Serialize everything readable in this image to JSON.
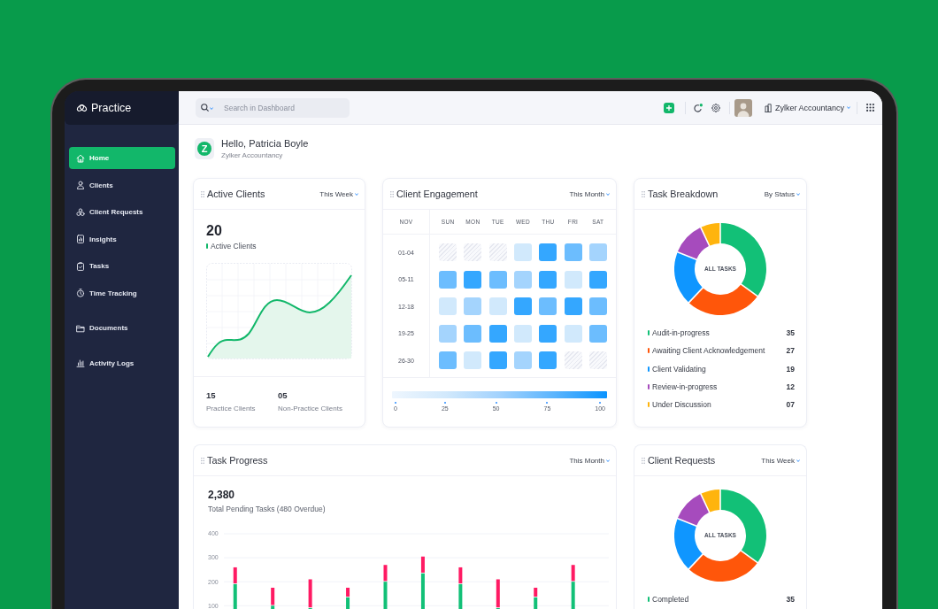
{
  "sidebar": {
    "app_name": "Practice",
    "sections": [
      {
        "items": [
          {
            "label": "Home",
            "selected": true
          },
          {
            "label": "Clients",
            "selected": false
          },
          {
            "label": "Client Requests",
            "selected": false
          },
          {
            "label": "Insights",
            "selected": false
          },
          {
            "label": "Tasks",
            "selected": false
          },
          {
            "label": "Time Tracking",
            "selected": false
          }
        ]
      },
      {
        "items": [
          {
            "label": "Documents",
            "selected": false
          }
        ]
      },
      {
        "items": [
          {
            "label": "Activity Logs",
            "selected": false
          }
        ]
      }
    ]
  },
  "top_bar": {
    "search": {
      "placeholder": "Search in Dashboard"
    },
    "organization": "Zylker Accountancy"
  },
  "greeting": {
    "logo_text": "Z",
    "title": "Hello, Patricia Boyle",
    "subtitle": "Zylker Accountancy"
  },
  "active_clients": {
    "title": "Active Clients",
    "period": "This Week",
    "count": "20",
    "count_label": "Active Clients",
    "stats": [
      {
        "value": "15",
        "label": "Practice Clients"
      },
      {
        "value": "05",
        "label": "Non-Practice Clients"
      }
    ]
  },
  "client_engagement": {
    "title": "Client Engagement",
    "period": "This Month",
    "month": "NOV",
    "days": [
      "SUN",
      "MON",
      "TUE",
      "WED",
      "THU",
      "FRI",
      "SAT"
    ],
    "rows": [
      {
        "label": "01-04",
        "cells": [
          {
            "kind": "blank"
          },
          {
            "kind": "blank"
          },
          {
            "kind": "blank"
          },
          {
            "kind": "filled",
            "color": "#d1e9fc"
          },
          {
            "kind": "filled",
            "color": "#34a7ff"
          },
          {
            "kind": "filled",
            "color": "#6cbdfe"
          },
          {
            "kind": "filled",
            "color": "#a4d4fd"
          }
        ]
      },
      {
        "label": "05-11",
        "cells": [
          {
            "kind": "filled",
            "color": "#6cbdfe"
          },
          {
            "kind": "filled",
            "color": "#34a7ff"
          },
          {
            "kind": "filled",
            "color": "#6cbdfe"
          },
          {
            "kind": "filled",
            "color": "#a4d4fd"
          },
          {
            "kind": "filled",
            "color": "#34a7ff"
          },
          {
            "kind": "filled",
            "color": "#d1e9fc"
          },
          {
            "kind": "filled",
            "color": "#34a7ff"
          }
        ]
      },
      {
        "label": "12-18",
        "cells": [
          {
            "kind": "filled",
            "color": "#d1e9fc"
          },
          {
            "kind": "filled",
            "color": "#a4d4fd"
          },
          {
            "kind": "filled",
            "color": "#d1e9fc"
          },
          {
            "kind": "filled",
            "color": "#34a7ff"
          },
          {
            "kind": "filled",
            "color": "#6cbdfe"
          },
          {
            "kind": "filled",
            "color": "#34a7ff"
          },
          {
            "kind": "filled",
            "color": "#6cbdfe"
          }
        ]
      },
      {
        "label": "19-25",
        "cells": [
          {
            "kind": "filled",
            "color": "#a4d4fd"
          },
          {
            "kind": "filled",
            "color": "#6cbdfe"
          },
          {
            "kind": "filled",
            "color": "#34a7ff"
          },
          {
            "kind": "filled",
            "color": "#d1e9fc"
          },
          {
            "kind": "filled",
            "color": "#34a7ff"
          },
          {
            "kind": "filled",
            "color": "#d1e9fc"
          },
          {
            "kind": "filled",
            "color": "#6cbdfe"
          }
        ]
      },
      {
        "label": "26-30",
        "cells": [
          {
            "kind": "filled",
            "color": "#6cbdfe"
          },
          {
            "kind": "filled",
            "color": "#d1e9fc"
          },
          {
            "kind": "filled",
            "color": "#34a7ff"
          },
          {
            "kind": "filled",
            "color": "#a4d4fd"
          },
          {
            "kind": "filled",
            "color": "#34a7ff"
          },
          {
            "kind": "blank"
          },
          {
            "kind": "blank"
          }
        ]
      }
    ],
    "scale_ticks": [
      "0",
      "25",
      "50",
      "75",
      "100"
    ]
  },
  "task_breakdown": {
    "title": "Task Breakdown",
    "period": "By Status",
    "center_label": "ALL TASKS",
    "chart_data": {
      "type": "donut",
      "categories": [
        "Audit-in-progress",
        "Awaiting Client Acknowledgement",
        "Client Validating",
        "Review-in-progress",
        "Under Discussion"
      ],
      "values": [
        35,
        27,
        19,
        12,
        7
      ],
      "value_labels": [
        "35",
        "27",
        "19",
        "12",
        "07"
      ],
      "colors": [
        "#12c077",
        "#ff560a",
        "#0f96ff",
        "#a64bbd",
        "#ffb40d"
      ]
    }
  },
  "task_progress": {
    "title": "Task Progress",
    "period": "This Month",
    "total": "2,380",
    "caption": "Total Pending Tasks (480 Overdue)",
    "chart_data": {
      "type": "bar",
      "stacked": true,
      "grid": true,
      "ylim": [
        0,
        400
      ],
      "yticks": [
        100,
        200,
        300,
        400
      ],
      "series": [
        {
          "color": "#12c077",
          "values": [
            190,
            100,
            90,
            135,
            200,
            235,
            190,
            90,
            135,
            200
          ]
        },
        {
          "color": "#ff1a63",
          "values": [
            70,
            75,
            120,
            40,
            70,
            70,
            70,
            120,
            40,
            70
          ]
        }
      ]
    }
  },
  "client_requests": {
    "title": "Client Requests",
    "period": "This Week",
    "center_label": "ALL TASKS",
    "legend": [
      {
        "label": "Completed",
        "value": "35",
        "color": "#12c077"
      }
    ]
  }
}
